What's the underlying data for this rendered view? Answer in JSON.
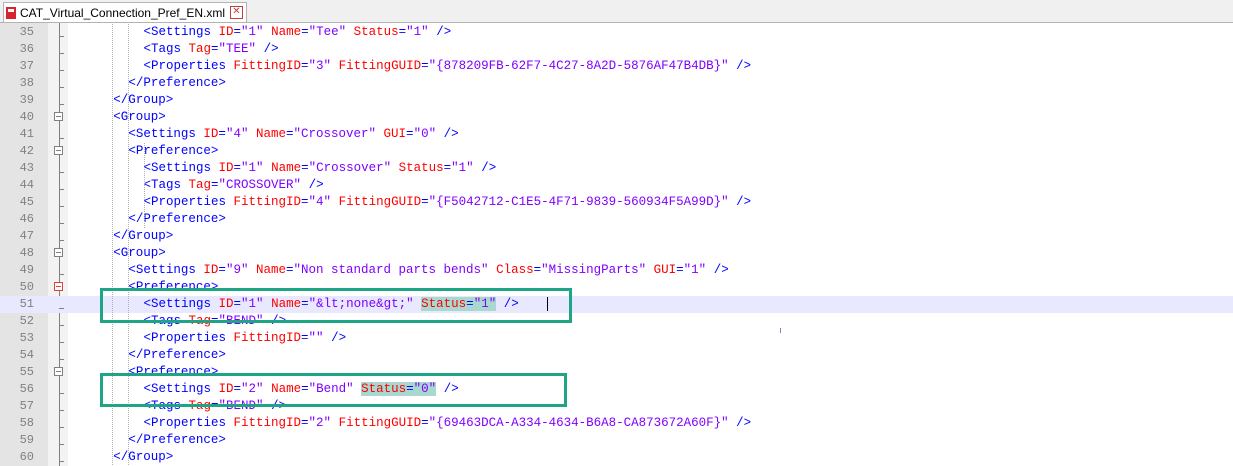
{
  "tab": {
    "title": "CAT_Virtual_Connection_Pref_EN.xml",
    "file_icon": "xml-file-icon",
    "close_icon": "close-icon",
    "close_symbol": "✕"
  },
  "editor": {
    "lines": [
      {
        "num": "35",
        "indent": 10,
        "tokens": [
          {
            "k": "t",
            "s": "<Settings "
          },
          {
            "k": "a",
            "s": "ID"
          },
          {
            "k": "t",
            "s": "="
          },
          {
            "k": "v",
            "s": "\"1\""
          },
          {
            "k": "t",
            "s": " "
          },
          {
            "k": "a",
            "s": "Name"
          },
          {
            "k": "t",
            "s": "="
          },
          {
            "k": "v",
            "s": "\"Tee\""
          },
          {
            "k": "t",
            "s": " "
          },
          {
            "k": "a",
            "s": "Status"
          },
          {
            "k": "t",
            "s": "="
          },
          {
            "k": "v",
            "s": "\"1\""
          },
          {
            "k": "t",
            "s": " />"
          }
        ]
      },
      {
        "num": "36",
        "indent": 10,
        "tokens": [
          {
            "k": "t",
            "s": "<Tags "
          },
          {
            "k": "a",
            "s": "Tag"
          },
          {
            "k": "t",
            "s": "="
          },
          {
            "k": "v",
            "s": "\"TEE\""
          },
          {
            "k": "t",
            "s": " />"
          }
        ]
      },
      {
        "num": "37",
        "indent": 10,
        "tokens": [
          {
            "k": "t",
            "s": "<Properties "
          },
          {
            "k": "a",
            "s": "FittingID"
          },
          {
            "k": "t",
            "s": "="
          },
          {
            "k": "v",
            "s": "\"3\""
          },
          {
            "k": "t",
            "s": " "
          },
          {
            "k": "a",
            "s": "FittingGUID"
          },
          {
            "k": "t",
            "s": "="
          },
          {
            "k": "v",
            "s": "\"{878209FB-62F7-4C27-8A2D-5876AF47B4DB}\""
          },
          {
            "k": "t",
            "s": " />"
          }
        ]
      },
      {
        "num": "38",
        "indent": 8,
        "tokens": [
          {
            "k": "t",
            "s": "</Preference>"
          }
        ]
      },
      {
        "num": "39",
        "indent": 6,
        "tokens": [
          {
            "k": "t",
            "s": "</Group>"
          }
        ]
      },
      {
        "num": "40",
        "indent": 6,
        "fold": true,
        "tokens": [
          {
            "k": "t",
            "s": "<Group>"
          }
        ]
      },
      {
        "num": "41",
        "indent": 8,
        "tokens": [
          {
            "k": "t",
            "s": "<Settings "
          },
          {
            "k": "a",
            "s": "ID"
          },
          {
            "k": "t",
            "s": "="
          },
          {
            "k": "v",
            "s": "\"4\""
          },
          {
            "k": "t",
            "s": " "
          },
          {
            "k": "a",
            "s": "Name"
          },
          {
            "k": "t",
            "s": "="
          },
          {
            "k": "v",
            "s": "\"Crossover\""
          },
          {
            "k": "t",
            "s": " "
          },
          {
            "k": "a",
            "s": "GUI"
          },
          {
            "k": "t",
            "s": "="
          },
          {
            "k": "v",
            "s": "\"0\""
          },
          {
            "k": "t",
            "s": " />"
          }
        ]
      },
      {
        "num": "42",
        "indent": 8,
        "fold": true,
        "tokens": [
          {
            "k": "t",
            "s": "<Preference>"
          }
        ]
      },
      {
        "num": "43",
        "indent": 10,
        "tokens": [
          {
            "k": "t",
            "s": "<Settings "
          },
          {
            "k": "a",
            "s": "ID"
          },
          {
            "k": "t",
            "s": "="
          },
          {
            "k": "v",
            "s": "\"1\""
          },
          {
            "k": "t",
            "s": " "
          },
          {
            "k": "a",
            "s": "Name"
          },
          {
            "k": "t",
            "s": "="
          },
          {
            "k": "v",
            "s": "\"Crossover\""
          },
          {
            "k": "t",
            "s": " "
          },
          {
            "k": "a",
            "s": "Status"
          },
          {
            "k": "t",
            "s": "="
          },
          {
            "k": "v",
            "s": "\"1\""
          },
          {
            "k": "t",
            "s": " />"
          }
        ]
      },
      {
        "num": "44",
        "indent": 10,
        "tokens": [
          {
            "k": "t",
            "s": "<Tags "
          },
          {
            "k": "a",
            "s": "Tag"
          },
          {
            "k": "t",
            "s": "="
          },
          {
            "k": "v",
            "s": "\"CROSSOVER\""
          },
          {
            "k": "t",
            "s": " />"
          }
        ]
      },
      {
        "num": "45",
        "indent": 10,
        "tokens": [
          {
            "k": "t",
            "s": "<Properties "
          },
          {
            "k": "a",
            "s": "FittingID"
          },
          {
            "k": "t",
            "s": "="
          },
          {
            "k": "v",
            "s": "\"4\""
          },
          {
            "k": "t",
            "s": " "
          },
          {
            "k": "a",
            "s": "FittingGUID"
          },
          {
            "k": "t",
            "s": "="
          },
          {
            "k": "v",
            "s": "\"{F5042712-C1E5-4F71-9839-560934F5A99D}\""
          },
          {
            "k": "t",
            "s": " />"
          }
        ]
      },
      {
        "num": "46",
        "indent": 8,
        "tokens": [
          {
            "k": "t",
            "s": "</Preference>"
          }
        ]
      },
      {
        "num": "47",
        "indent": 6,
        "tokens": [
          {
            "k": "t",
            "s": "</Group>"
          }
        ]
      },
      {
        "num": "48",
        "indent": 6,
        "fold": true,
        "tokens": [
          {
            "k": "t",
            "s": "<Group>"
          }
        ]
      },
      {
        "num": "49",
        "indent": 8,
        "tokens": [
          {
            "k": "t",
            "s": "<Settings "
          },
          {
            "k": "a",
            "s": "ID"
          },
          {
            "k": "t",
            "s": "="
          },
          {
            "k": "v",
            "s": "\"9\""
          },
          {
            "k": "t",
            "s": " "
          },
          {
            "k": "a",
            "s": "Name"
          },
          {
            "k": "t",
            "s": "="
          },
          {
            "k": "v",
            "s": "\"Non standard parts bends\""
          },
          {
            "k": "t",
            "s": " "
          },
          {
            "k": "a",
            "s": "Class"
          },
          {
            "k": "t",
            "s": "="
          },
          {
            "k": "v",
            "s": "\"MissingParts\""
          },
          {
            "k": "t",
            "s": " "
          },
          {
            "k": "a",
            "s": "GUI"
          },
          {
            "k": "t",
            "s": "="
          },
          {
            "k": "v",
            "s": "\"1\""
          },
          {
            "k": "t",
            "s": " />"
          }
        ]
      },
      {
        "num": "50",
        "indent": 8,
        "fold": true,
        "foldRed": true,
        "tokens": [
          {
            "k": "t",
            "s": "<Preference>"
          }
        ]
      },
      {
        "num": "51",
        "indent": 10,
        "current": true,
        "tokens": [
          {
            "k": "t",
            "s": "<Settings "
          },
          {
            "k": "a",
            "s": "ID"
          },
          {
            "k": "t",
            "s": "="
          },
          {
            "k": "v",
            "s": "\"1\""
          },
          {
            "k": "t",
            "s": " "
          },
          {
            "k": "a",
            "s": "Name"
          },
          {
            "k": "t",
            "s": "="
          },
          {
            "k": "v",
            "s": "\"&lt;none&gt;\""
          },
          {
            "k": "t",
            "s": " "
          },
          {
            "k": "a",
            "s": "Status",
            "h": true
          },
          {
            "k": "t",
            "s": "=",
            "h": true
          },
          {
            "k": "v",
            "s": "\"1\"",
            "h": true
          },
          {
            "k": "t",
            "s": " />"
          }
        ]
      },
      {
        "num": "52",
        "indent": 10,
        "tokens": [
          {
            "k": "t",
            "s": "<Tags "
          },
          {
            "k": "a",
            "s": "Tag"
          },
          {
            "k": "t",
            "s": "="
          },
          {
            "k": "v",
            "s": "\"BEND\""
          },
          {
            "k": "t",
            "s": " />"
          }
        ]
      },
      {
        "num": "53",
        "indent": 10,
        "tokens": [
          {
            "k": "t",
            "s": "<Properties "
          },
          {
            "k": "a",
            "s": "FittingID"
          },
          {
            "k": "t",
            "s": "="
          },
          {
            "k": "v",
            "s": "\"\""
          },
          {
            "k": "t",
            "s": " />"
          }
        ]
      },
      {
        "num": "54",
        "indent": 8,
        "tokens": [
          {
            "k": "t",
            "s": "</Preference>"
          }
        ]
      },
      {
        "num": "55",
        "indent": 8,
        "fold": true,
        "tokens": [
          {
            "k": "t",
            "s": "<Preference>"
          }
        ]
      },
      {
        "num": "56",
        "indent": 10,
        "tokens": [
          {
            "k": "t",
            "s": "<Settings "
          },
          {
            "k": "a",
            "s": "ID"
          },
          {
            "k": "t",
            "s": "="
          },
          {
            "k": "v",
            "s": "\"2\""
          },
          {
            "k": "t",
            "s": " "
          },
          {
            "k": "a",
            "s": "Name"
          },
          {
            "k": "t",
            "s": "="
          },
          {
            "k": "v",
            "s": "\"Bend\""
          },
          {
            "k": "t",
            "s": " "
          },
          {
            "k": "a",
            "s": "Status",
            "h": true
          },
          {
            "k": "t",
            "s": "=",
            "h": true
          },
          {
            "k": "v",
            "s": "\"0\"",
            "h": true
          },
          {
            "k": "t",
            "s": " />"
          }
        ]
      },
      {
        "num": "57",
        "indent": 10,
        "tokens": [
          {
            "k": "t",
            "s": "<Tags "
          },
          {
            "k": "a",
            "s": "Tag"
          },
          {
            "k": "t",
            "s": "="
          },
          {
            "k": "v",
            "s": "\"BEND\""
          },
          {
            "k": "t",
            "s": " />"
          }
        ]
      },
      {
        "num": "58",
        "indent": 10,
        "tokens": [
          {
            "k": "t",
            "s": "<Properties "
          },
          {
            "k": "a",
            "s": "FittingID"
          },
          {
            "k": "t",
            "s": "="
          },
          {
            "k": "v",
            "s": "\"2\""
          },
          {
            "k": "t",
            "s": " "
          },
          {
            "k": "a",
            "s": "FittingGUID"
          },
          {
            "k": "t",
            "s": "="
          },
          {
            "k": "v",
            "s": "\"{69463DCA-A334-4634-B6A8-CA873672A60F}\""
          },
          {
            "k": "t",
            "s": " />"
          }
        ]
      },
      {
        "num": "59",
        "indent": 8,
        "tokens": [
          {
            "k": "t",
            "s": "</Preference>"
          }
        ]
      },
      {
        "num": "60",
        "indent": 6,
        "tokens": [
          {
            "k": "t",
            "s": "</Group>"
          }
        ]
      }
    ]
  },
  "colors": {
    "tag": "#0000ff",
    "attribute": "#ff0000",
    "value": "#8000ff",
    "highlight": "#a8d8d0",
    "annotation": "#1ea585",
    "current_line": "#e8e8ff"
  }
}
